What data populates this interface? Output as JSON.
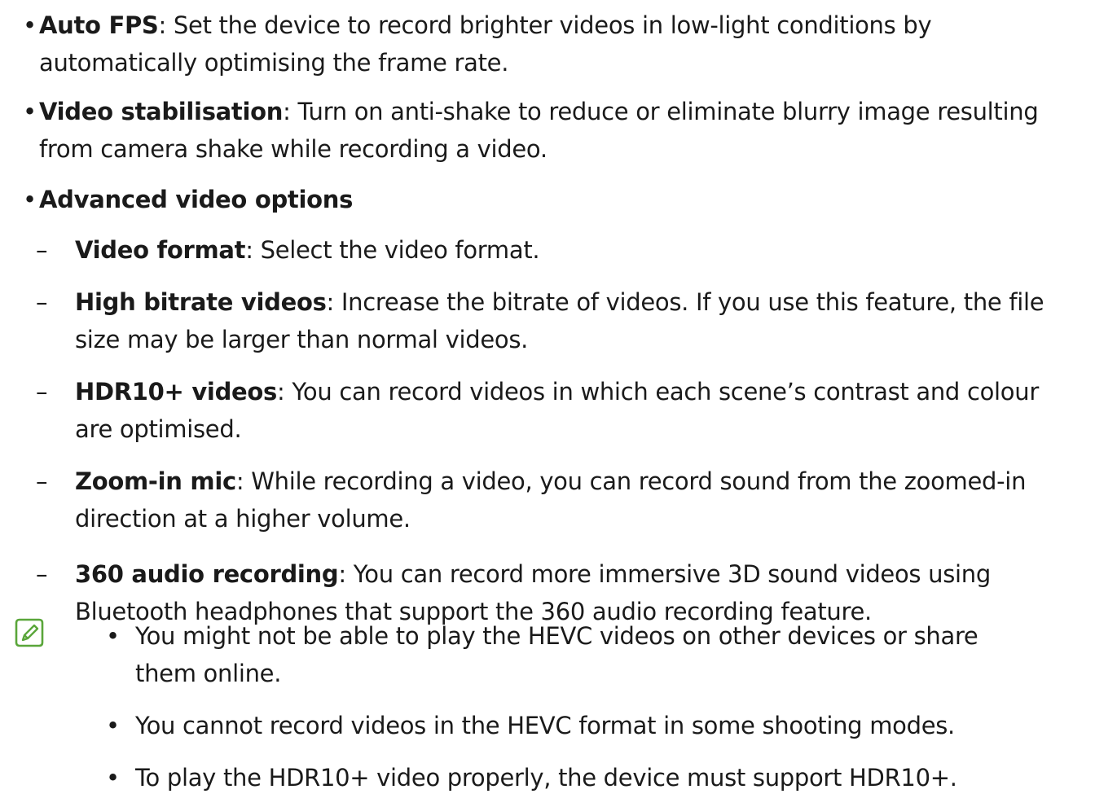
{
  "bullets": [
    {
      "term": "Auto FPS",
      "line1": ": Set the device to record brighter videos in low-light conditions by",
      "line2": "automatically optimising the frame rate."
    },
    {
      "term": "Video stabilisation",
      "line1": ": Turn on anti-shake to reduce or eliminate blurry image resulting",
      "line2": "from camera shake while recording a video."
    },
    {
      "term": "Advanced video options"
    }
  ],
  "sub_items": [
    {
      "term": "Video format",
      "line1": ": Select the video format."
    },
    {
      "term": "High bitrate videos",
      "line1": ": Increase the bitrate of videos. If you use this feature, the file",
      "line2": "size may be larger than normal videos."
    },
    {
      "term": "HDR10+ videos",
      "line1": ": You can record videos in which each scene’s contrast and colour",
      "line2": "are optimised."
    },
    {
      "term": "Zoom-in mic",
      "line1": ": While recording a video, you can record sound from the zoomed-in",
      "line2": "direction at a higher volume."
    },
    {
      "term": "360 audio recording",
      "line1": ": You can record more immersive 3D sound videos using",
      "line2": "Bluetooth headphones that support the 360 audio recording feature."
    }
  ],
  "notes": [
    {
      "line1": "You might not be able to play the HEVC videos on other devices or share",
      "line2": "them online."
    },
    {
      "line1": "You cannot record videos in the HEVC format in some shooting modes."
    },
    {
      "line1": "To play the HDR10+ video properly, the device must support HDR10+."
    }
  ],
  "symbols": {
    "bullet": "•",
    "dash": "–"
  },
  "note_icon": "note-icon",
  "colors": {
    "text": "#1a1a1a",
    "note_icon": "#5aa63a"
  }
}
